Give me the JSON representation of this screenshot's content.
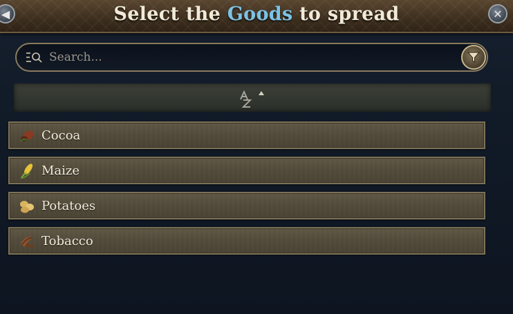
{
  "header": {
    "title_prefix": "Select the ",
    "title_highlight": "Goods",
    "title_suffix": " to spread",
    "highlight_color": "#7cc3e6",
    "back_icon": "arrow-left-icon",
    "close_icon": "close-icon"
  },
  "search": {
    "placeholder": "Search...",
    "value": "",
    "search_icon": "search-list-icon",
    "filter_icon": "funnel-filter-icon"
  },
  "sort": {
    "icon": "sort-alphabetical-icon",
    "direction": "ascending"
  },
  "goods": [
    {
      "label": "Cocoa",
      "icon": "cocoa-icon"
    },
    {
      "label": "Maize",
      "icon": "maize-icon"
    },
    {
      "label": "Potatoes",
      "icon": "potatoes-icon"
    },
    {
      "label": "Tobacco",
      "icon": "tobacco-icon"
    }
  ]
}
